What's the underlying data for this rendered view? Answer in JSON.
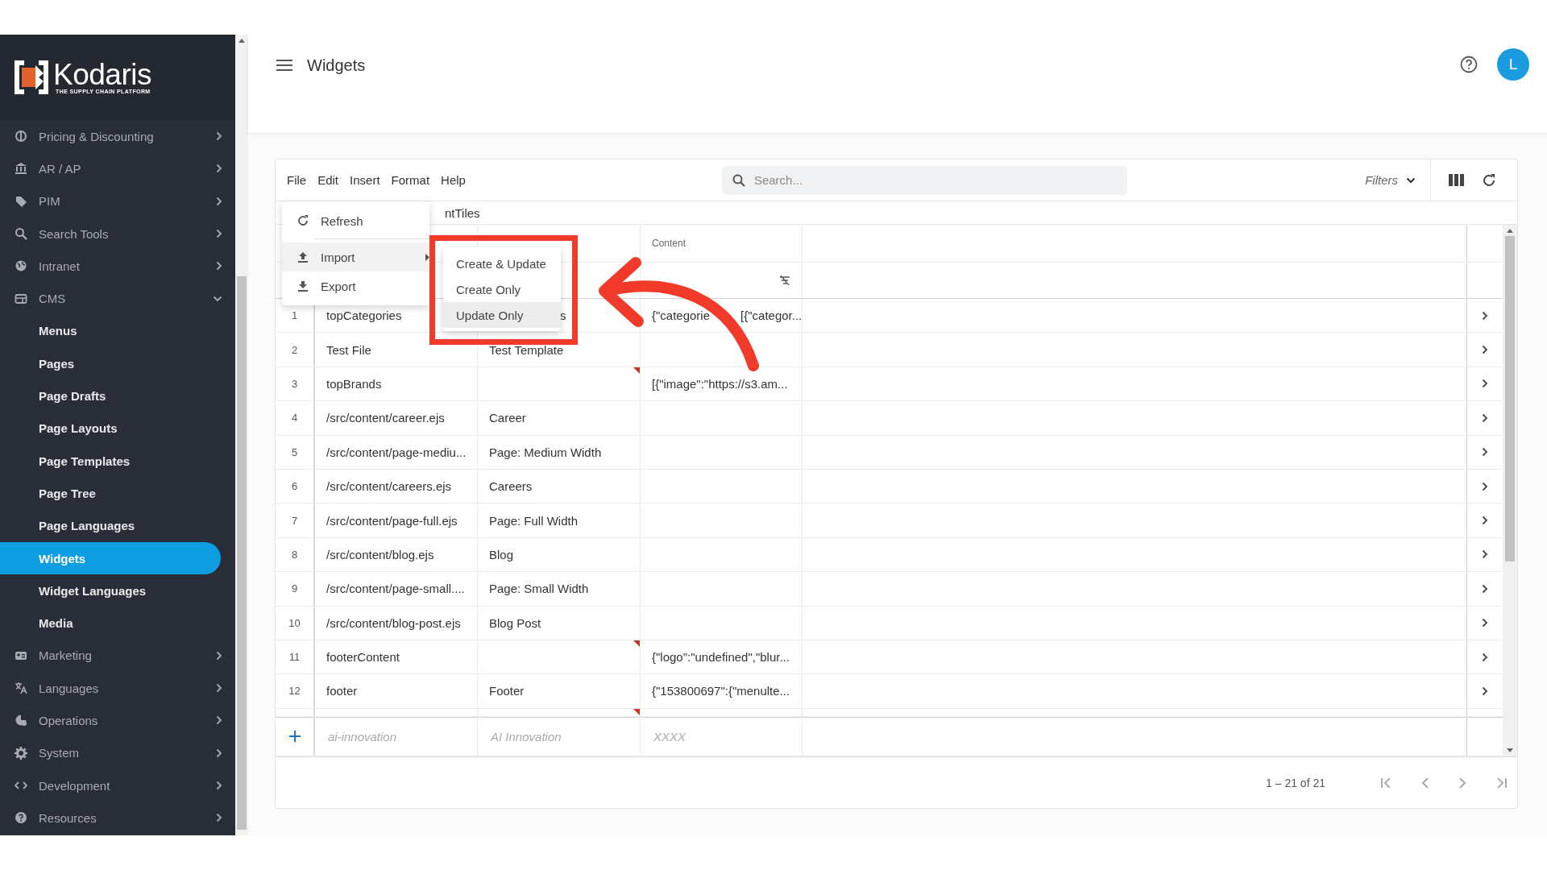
{
  "brand": {
    "name": "Kodaris",
    "tagline": "THE SUPPLY CHAIN PLATFORM"
  },
  "sidebar": {
    "items": [
      {
        "label": "Pricing & Discounting",
        "expanded": false
      },
      {
        "label": "AR / AP",
        "expanded": false
      },
      {
        "label": "PIM",
        "expanded": false
      },
      {
        "label": "Search Tools",
        "expanded": false
      },
      {
        "label": "Intranet",
        "expanded": false
      },
      {
        "label": "CMS",
        "expanded": true,
        "children": [
          {
            "label": "Menus",
            "selected": false
          },
          {
            "label": "Pages",
            "selected": false
          },
          {
            "label": "Page Drafts",
            "selected": false
          },
          {
            "label": "Page Layouts",
            "selected": false
          },
          {
            "label": "Page Templates",
            "selected": false
          },
          {
            "label": "Page Tree",
            "selected": false
          },
          {
            "label": "Page Languages",
            "selected": false
          },
          {
            "label": "Widgets",
            "selected": true
          },
          {
            "label": "Widget Languages",
            "selected": false
          },
          {
            "label": "Media",
            "selected": false
          }
        ]
      },
      {
        "label": "Marketing",
        "expanded": false
      },
      {
        "label": "Languages",
        "expanded": false
      },
      {
        "label": "Operations",
        "expanded": false
      },
      {
        "label": "System",
        "expanded": false
      },
      {
        "label": "Development",
        "expanded": false
      },
      {
        "label": "Resources",
        "expanded": false
      }
    ]
  },
  "header": {
    "title": "Widgets",
    "avatar": "L"
  },
  "toolbar": {
    "menus": [
      "File",
      "Edit",
      "Insert",
      "Format",
      "Help"
    ],
    "search": {
      "placeholder": "Search..."
    },
    "filters": "Filters"
  },
  "subtitle": "ntTiles",
  "file_menu": {
    "items": [
      {
        "kind": "item",
        "label": "Refresh",
        "highlighted": false
      },
      {
        "kind": "divider"
      },
      {
        "kind": "submenu",
        "label": "Import",
        "highlighted": true
      },
      {
        "kind": "item",
        "label": "Export",
        "highlighted": false
      }
    ]
  },
  "import_menu": {
    "items": [
      {
        "label": "Create & Update",
        "highlighted": false
      },
      {
        "label": "Create Only",
        "highlighted": false
      },
      {
        "label": "Update Only",
        "highlighted": true
      }
    ]
  },
  "grid": {
    "content_header": "Content",
    "rows": [
      {
        "number": "1",
        "name": "topCategories",
        "title": "s",
        "title_covered": true,
        "content_parts": [
          "{\"categorie",
          "[{\"categor..."
        ],
        "flagged": false
      },
      {
        "number": "2",
        "name": "Test File",
        "title": "Test Template",
        "flagged": false
      },
      {
        "number": "3",
        "name": "topBrands",
        "content": "[{\"image\":\"https://s3.am...",
        "flagged": true
      },
      {
        "number": "4",
        "name": "/src/content/career.ejs",
        "title": "Career",
        "flagged": false
      },
      {
        "number": "5",
        "name": "/src/content/page-mediu...",
        "title": "Page: Medium Width",
        "flagged": false
      },
      {
        "number": "6",
        "name": "/src/content/careers.ejs",
        "title": "Careers",
        "flagged": false
      },
      {
        "number": "7",
        "name": "/src/content/page-full.ejs",
        "title": "Page: Full Width",
        "flagged": false
      },
      {
        "number": "8",
        "name": "/src/content/blog.ejs",
        "title": "Blog",
        "flagged": false
      },
      {
        "number": "9",
        "name": "/src/content/page-small....",
        "title": "Page: Small Width",
        "flagged": false
      },
      {
        "number": "10",
        "name": "/src/content/blog-post.ejs",
        "title": "Blog Post",
        "flagged": false
      },
      {
        "number": "11",
        "name": "footerContent",
        "content": "{\"logo\":\"undefined\",\"blur...",
        "flagged": true
      },
      {
        "number": "12",
        "name": "footer",
        "title": "Footer",
        "content": "{\"153800697\":{\"menulte...",
        "flagged": false
      },
      {
        "partial": true,
        "flagged": true
      }
    ],
    "new_row": {
      "name": {
        "placeholder": "ai-innovation"
      },
      "title": {
        "placeholder": "AI Innovation"
      },
      "content": {
        "placeholder": "XXXX"
      }
    }
  },
  "pagination": {
    "range": "1 – 21 of 21"
  }
}
